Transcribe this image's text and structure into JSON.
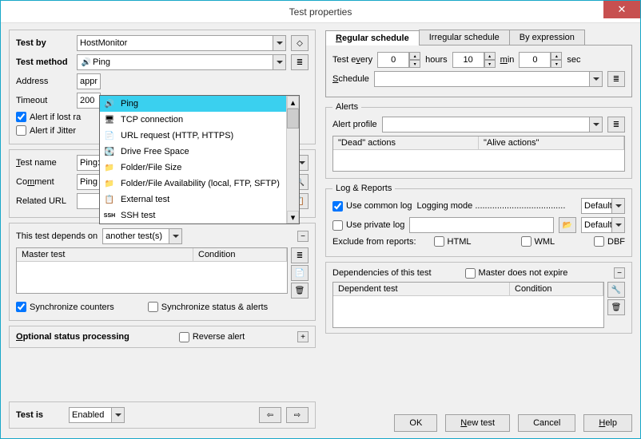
{
  "title": "Test properties",
  "left": {
    "test_by_label": "Test by",
    "test_by_value": "HostMonitor",
    "test_method_label": "Test method",
    "test_method_value": "Ping",
    "test_method_options": [
      {
        "label": "Ping",
        "icon": "🔊"
      },
      {
        "label": "TCP connection",
        "icon": "🖥"
      },
      {
        "label": "URL request (HTTP, HTTPS)",
        "icon": "📄"
      },
      {
        "label": "Drive Free Space",
        "icon": "💽"
      },
      {
        "label": "Folder/File Size",
        "icon": "📁"
      },
      {
        "label": "Folder/File Availability (local, FTP, SFTP)",
        "icon": "📁"
      },
      {
        "label": "External test",
        "icon": "📋"
      },
      {
        "label": "SSH test",
        "icon": "SSH"
      }
    ],
    "address_label": "Address",
    "address_value": "appne",
    "timeout_label": "Timeout",
    "timeout_value": "200",
    "alert_lost_label": "Alert if lost ra",
    "alert_jitter_label": "Alert if Jitter",
    "test_name_label": "Test name",
    "test_name_value": "Ping: appnee.com",
    "comment_label": "Comment",
    "comment_value": "Ping appnee.com",
    "related_url_label": "Related URL",
    "related_url_value": "",
    "depends_title": "This test depends on",
    "depends_value": "another test(s)",
    "col_master": "Master test",
    "col_condition": "Condition",
    "sync_counters": "Synchronize counters",
    "sync_status": "Synchronize status & alerts",
    "optional_title": "Optional status processing",
    "reverse_alert": "Reverse alert",
    "test_is_label": "Test is",
    "test_is_value": "Enabled"
  },
  "right": {
    "tab_regular": "Regular schedule",
    "tab_irregular": "Irregular schedule",
    "tab_expression": "By expression",
    "test_every": "Test every",
    "hours_label": "hours",
    "hours_value": "0",
    "min_label": "min",
    "min_value": "10",
    "sec_label": "sec",
    "sec_value": "0",
    "schedule_label": "Schedule",
    "alerts_title": "Alerts",
    "alert_profile": "Alert profile",
    "dead_actions": "\"Dead\"  actions",
    "alive_actions": "\"Alive actions\"",
    "log_title": "Log & Reports",
    "use_common": "Use common log",
    "logging_mode": "Logging mode .....................................",
    "use_private": "Use private log",
    "default_label": "Default",
    "exclude_label": "Exclude from reports:",
    "html": "HTML",
    "wml": "WML",
    "dbf": "DBF",
    "deps_title": "Dependencies of this test",
    "master_expire": "Master does not expire",
    "col_dependent": "Dependent test",
    "col_condition2": "Condition"
  },
  "buttons": {
    "ok": "OK",
    "new_test": "New test",
    "cancel": "Cancel",
    "help": "Help"
  }
}
